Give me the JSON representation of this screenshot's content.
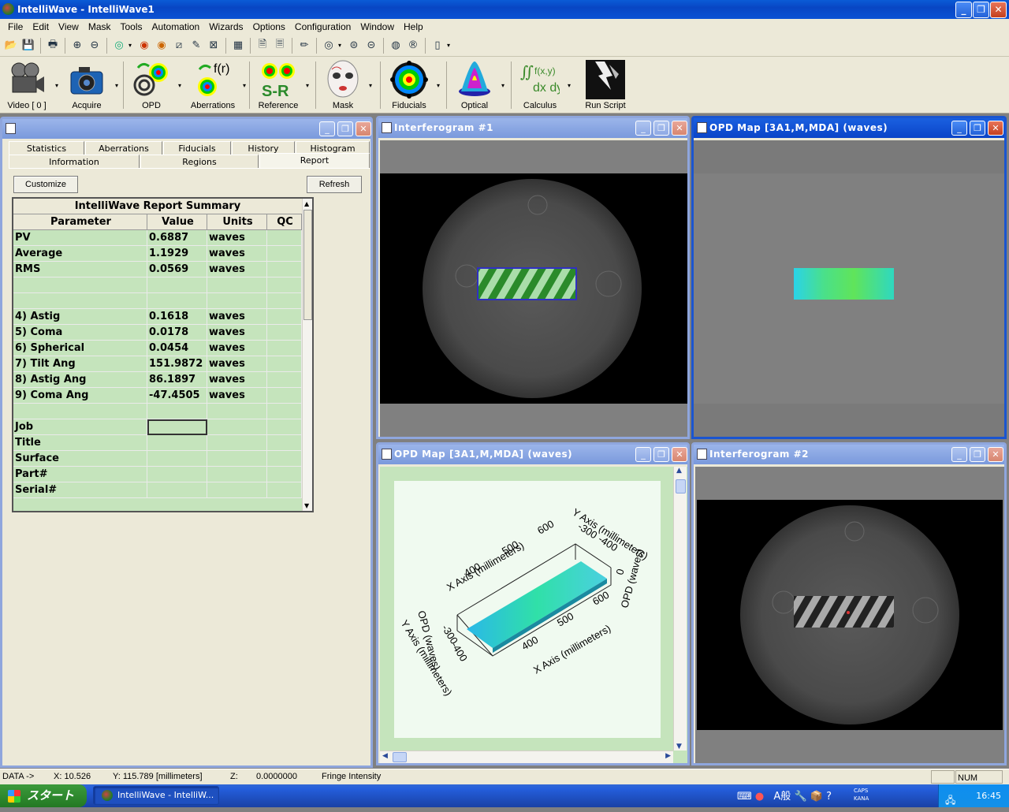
{
  "window": {
    "title": "IntelliWave - IntelliWave1"
  },
  "menu": [
    "File",
    "Edit",
    "View",
    "Mask",
    "Tools",
    "Automation",
    "Wizards",
    "Options",
    "Configuration",
    "Window",
    "Help"
  ],
  "big_tools": [
    {
      "label": "Video [ 0 ]",
      "icon": "video-camera-icon"
    },
    {
      "label": "Acquire",
      "icon": "camera-icon"
    },
    {
      "label": "OPD",
      "icon": "opd-icon"
    },
    {
      "label": "Aberrations",
      "icon": "aberrations-icon"
    },
    {
      "label": "Reference",
      "icon": "reference-icon",
      "text": "S-R"
    },
    {
      "label": "Mask",
      "icon": "mask-icon"
    },
    {
      "label": "Fiducials",
      "icon": "fiducials-icon"
    },
    {
      "label": "Optical",
      "icon": "optical-icon"
    },
    {
      "label": "Calculus",
      "icon": "calculus-icon",
      "text": "∬f(x,y) dx dy"
    },
    {
      "label": "Run Script",
      "icon": "lightning-icon"
    }
  ],
  "report": {
    "tabs_row1": [
      "Statistics",
      "Aberrations",
      "Fiducials",
      "History",
      "Histogram"
    ],
    "tabs_row2": [
      "Information",
      "Regions",
      "Report"
    ],
    "customize": "Customize",
    "refresh": "Refresh",
    "title": "IntelliWave Report Summary",
    "columns": [
      "Parameter",
      "Value",
      "Units",
      "QC"
    ],
    "rows": [
      {
        "p": "PV",
        "v": "0.6887",
        "u": "waves"
      },
      {
        "p": "Average",
        "v": "1.1929",
        "u": "waves"
      },
      {
        "p": "RMS",
        "v": "0.0569",
        "u": "waves"
      },
      {
        "p": "",
        "v": "",
        "u": ""
      },
      {
        "p": "",
        "v": "",
        "u": ""
      },
      {
        "p": " 4) Astig",
        "v": "0.1618",
        "u": "waves"
      },
      {
        "p": " 5) Coma",
        "v": "0.0178",
        "u": "waves"
      },
      {
        "p": " 6) Spherical",
        "v": "0.0454",
        "u": "waves"
      },
      {
        "p": " 7) Tilt Ang",
        "v": "151.9872",
        "u": "waves"
      },
      {
        "p": " 8) Astig Ang",
        "v": "86.1897",
        "u": "waves"
      },
      {
        "p": " 9) Coma Ang",
        "v": "-47.4505",
        "u": "waves"
      },
      {
        "p": "",
        "v": "",
        "u": ""
      },
      {
        "p": "Job",
        "v": "",
        "u": ""
      },
      {
        "p": "Title",
        "v": "",
        "u": ""
      },
      {
        "p": "Surface",
        "v": "",
        "u": ""
      },
      {
        "p": "Part#",
        "v": "",
        "u": ""
      },
      {
        "p": "Serial#",
        "v": "",
        "u": ""
      }
    ]
  },
  "windows": {
    "interferogram1": "Interferogram #1",
    "opd_map_top": "OPD Map [3A1,M,MDA]  (waves)",
    "opd_map_3d": "OPD Map [3A1,M,MDA]  (waves)",
    "interferogram2": "Interferogram #2"
  },
  "plot3d": {
    "x_axis": "X Axis  (millimeters)",
    "y_axis": "Y Axis  (millimeters)",
    "z_axis": "OPD  (waves)",
    "x_ticks_top": [
      "400",
      "500",
      "600"
    ],
    "x_ticks_bottom": [
      "400",
      "500",
      "600"
    ],
    "y_ticks_right": [
      "-300",
      "-400"
    ],
    "y_ticks_left": [
      "-300",
      "-400"
    ],
    "z_ticks": [
      "0"
    ]
  },
  "status": {
    "data": "DATA ->",
    "x": "X:  10.526",
    "y": "Y:  115.789  [millimeters]",
    "z": "Z:",
    "zval": "0.0000000",
    "mode": "Fringe Intensity",
    "num": "NUM"
  },
  "taskbar": {
    "start": "スタート",
    "app": "IntelliWave - IntelliW...",
    "ime1": "A般",
    "caps": "CAPS",
    "kana": "KANA",
    "time": "16:45"
  }
}
